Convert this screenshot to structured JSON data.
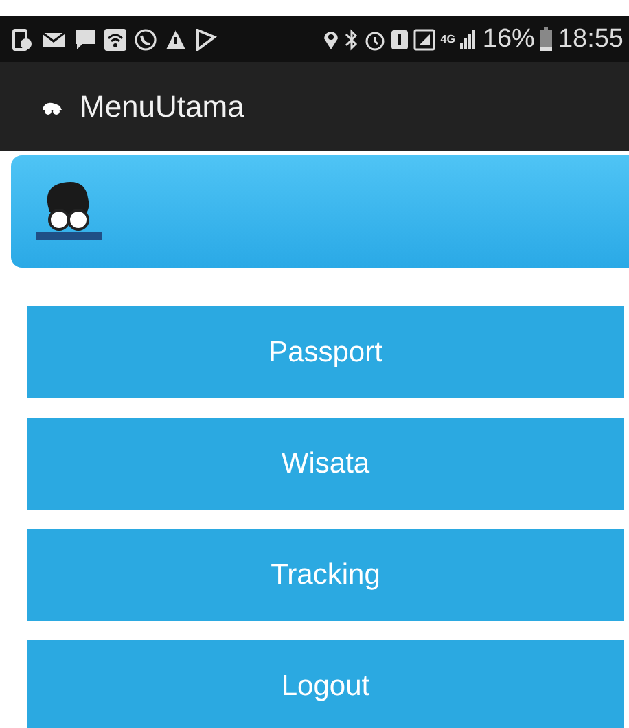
{
  "status_bar": {
    "network": "4G",
    "battery": "16%",
    "time": "18:55"
  },
  "app_bar": {
    "title": "MenuUtama"
  },
  "menu": [
    {
      "label": "Passport"
    },
    {
      "label": "Wisata"
    },
    {
      "label": "Tracking"
    },
    {
      "label": "Logout"
    }
  ]
}
